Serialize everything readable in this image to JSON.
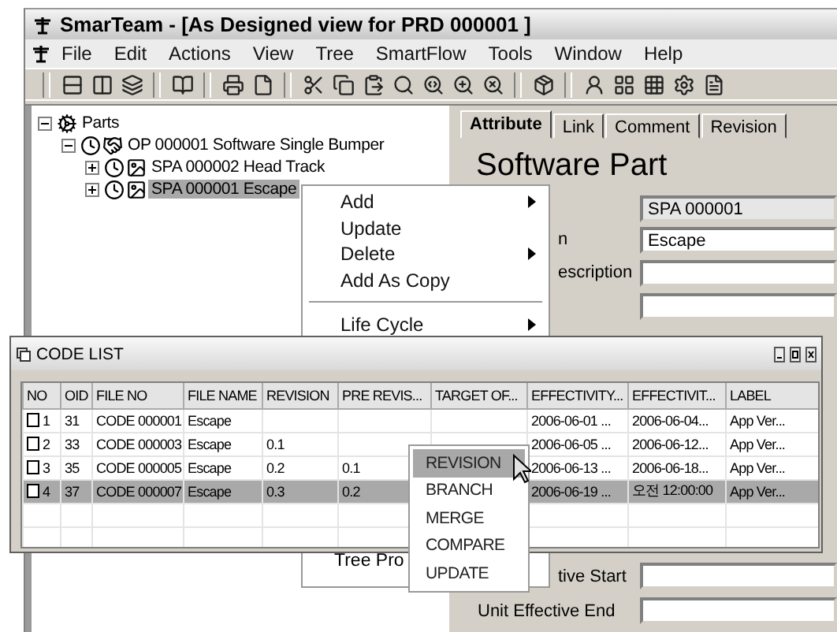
{
  "window": {
    "title": "SmarTeam - [As Designed view for PRD 000001 ]"
  },
  "menu_bar": [
    "File",
    "Edit",
    "Actions",
    "View",
    "Tree",
    "SmartFlow",
    "Tools",
    "Window",
    "Help"
  ],
  "tree": [
    {
      "label": "Parts",
      "expanded": true,
      "selected": false,
      "children": [
        {
          "label": "OP 000001  Software Single Bumper",
          "expanded": true,
          "selected": false,
          "children": [
            {
              "label": "SPA 000002  Head Track",
              "expanded": false,
              "selected": false
            },
            {
              "label": "SPA 000001  Escape",
              "expanded": false,
              "selected": true
            }
          ]
        }
      ]
    }
  ],
  "tabs": [
    {
      "label": "Attribute",
      "selected": true
    },
    {
      "label": "Link",
      "selected": false
    },
    {
      "label": "Comment",
      "selected": false
    },
    {
      "label": "Revision",
      "selected": false
    }
  ],
  "heading": "Software Part",
  "fields": [
    {
      "value": "SPA 000001",
      "disabled": true
    },
    {
      "label": "n",
      "covered": true,
      "disabled": false,
      "value": "Escape"
    },
    {
      "label": "escription",
      "covered": true,
      "disabled": false
    },
    {
      "disabled": false
    }
  ],
  "lower_fields": [
    {
      "label": "tive Start",
      "covered": true,
      "disabled": false
    },
    {
      "label": "Unit Effective End",
      "covered": false,
      "disabled": false
    }
  ],
  "context_menu": {
    "items": [
      {
        "label": "Add",
        "submenu": true
      },
      {
        "label": "Update",
        "submenu": false
      },
      {
        "label": "Delete",
        "submenu": true
      },
      {
        "label": "Add As Copy",
        "submenu": false
      },
      {
        "kind": "separator"
      },
      {
        "label": "Life Cycle",
        "submenu": true
      }
    ],
    "bottom_item": "Tree Pro"
  },
  "code_list": {
    "title": "CODE LIST",
    "columns": [
      "NO",
      "OID",
      "FILE NO",
      "FILE NAME",
      "REVISION",
      "PRE REVIS...",
      "TARGET OF...",
      "EFFECTIVITY...",
      "EFFECTIVIT...",
      "LABEL"
    ],
    "rows": [
      {
        "checked": false,
        "selected": false,
        "cells": [
          "1",
          "31",
          "CODE 000001",
          "Escape",
          null,
          null,
          null,
          "2006-06-01 ...",
          "2006-06-04...",
          "App Ver..."
        ]
      },
      {
        "checked": false,
        "selected": false,
        "cells": [
          "2",
          "33",
          "CODE 000003",
          "Escape",
          "0.1",
          null,
          null,
          "2006-06-05 ...",
          "2006-06-12...",
          "App Ver..."
        ]
      },
      {
        "checked": false,
        "selected": false,
        "cells": [
          "3",
          "35",
          "CODE 000005",
          "Escape",
          "0.2",
          "0.1",
          null,
          "2006-06-13 ...",
          "2006-06-18...",
          "App Ver..."
        ]
      },
      {
        "checked": false,
        "selected": true,
        "cells": [
          "4",
          "37",
          "CODE 000007",
          "Escape",
          "0.3",
          "0.2",
          null,
          "2006-06-19 ...",
          "오전 12:00:00",
          "App Ver..."
        ]
      }
    ]
  },
  "popup_menu": [
    {
      "label": "REVISION",
      "selected": true
    },
    {
      "label": "BRANCH",
      "selected": false
    },
    {
      "label": "MERGE",
      "selected": false
    },
    {
      "label": "COMPARE",
      "selected": false
    },
    {
      "label": "UPDATE",
      "selected": false
    }
  ]
}
